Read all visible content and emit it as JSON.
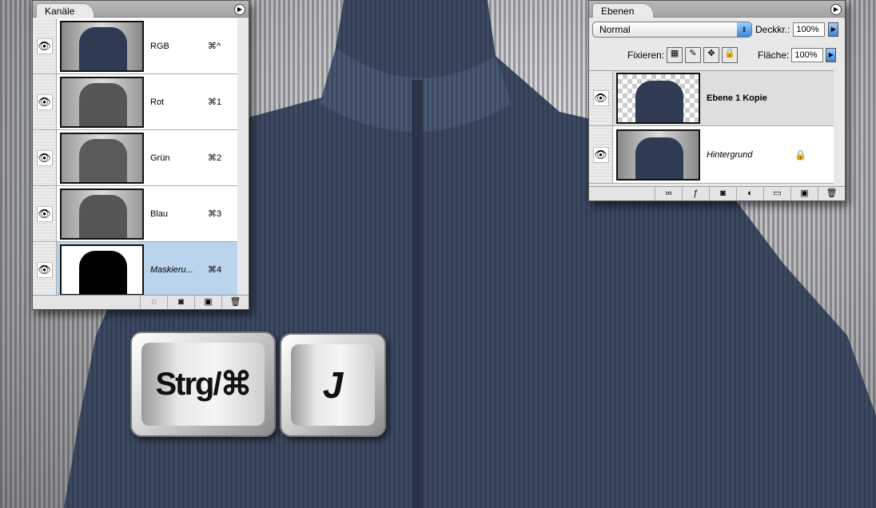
{
  "channels_panel": {
    "tab": "Kanäle",
    "rows": [
      {
        "name": "RGB",
        "shortcut": "⌘^"
      },
      {
        "name": "Rot",
        "shortcut": "⌘1"
      },
      {
        "name": "Grün",
        "shortcut": "⌘2"
      },
      {
        "name": "Blau",
        "shortcut": "⌘3"
      },
      {
        "name": "Maskieru...",
        "shortcut": "⌘4"
      }
    ]
  },
  "layers_panel": {
    "tab": "Ebenen",
    "blend_mode": "Normal",
    "opacity_label": "Deckkr.:",
    "opacity": "100%",
    "lock_label": "Fixieren:",
    "fill_label": "Fläche:",
    "fill": "100%",
    "layers": [
      {
        "name": "Ebene 1 Kopie"
      },
      {
        "name": "Hintergrund"
      }
    ]
  },
  "keys": {
    "modifier": "Strg/⌘",
    "letter": "J"
  },
  "colors": {
    "sweater": "#3c4a62",
    "selection": "#b9d4ec"
  }
}
